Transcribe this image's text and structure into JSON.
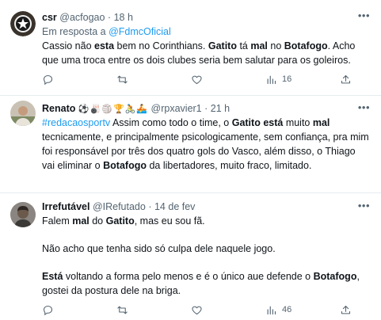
{
  "tweets": [
    {
      "name": "csr",
      "handle": "@acfogao",
      "time": "18 h",
      "reply_prefix": "Em resposta a ",
      "reply_to": "@FdmcOficial",
      "body": [
        {
          "t": "Cassio não "
        },
        {
          "t": "esta",
          "b": true
        },
        {
          "t": " bem no Corinthians. "
        },
        {
          "t": "Gatito",
          "b": true
        },
        {
          "t": " tá "
        },
        {
          "t": "mal",
          "b": true
        },
        {
          "t": " no "
        },
        {
          "t": "Botafogo",
          "b": true
        },
        {
          "t": ". Acho que uma troca entre os dois  clubes seria bem salutar para os goleiros."
        }
      ],
      "views": "16"
    },
    {
      "name": "Renato",
      "name_emojis": "⚽🎳🏐🏆🚴🚣",
      "handle": "@rpxavier1",
      "time": "21 h",
      "body": [
        {
          "t": "#redacaosportv",
          "link": true
        },
        {
          "t": " Assim como todo o time, o "
        },
        {
          "t": "Gatito",
          "b": true
        },
        {
          "t": " "
        },
        {
          "t": "está",
          "b": true
        },
        {
          "t": " muito "
        },
        {
          "t": "mal",
          "b": true
        },
        {
          "t": " tecnicamente, e principalmente psicologicamente, sem confiança, pra mim foi responsável por três dos quatro gols do Vasco, além disso, o Thiago vai eliminar o "
        },
        {
          "t": "Botafogo",
          "b": true
        },
        {
          "t": " da libertadores, muito fraco, limitado."
        }
      ]
    },
    {
      "name": "Irrefutável",
      "handle": "@IRefutado",
      "time": "14 de fev",
      "paragraphs": [
        [
          {
            "t": "Falem "
          },
          {
            "t": "mal",
            "b": true
          },
          {
            "t": " do "
          },
          {
            "t": "Gatito",
            "b": true
          },
          {
            "t": ", mas eu sou fã."
          }
        ],
        [
          {
            "t": "Não acho que tenha sido só culpa dele naquele jogo."
          }
        ],
        [
          {
            "t": "Está",
            "b": true
          },
          {
            "t": " voltando a forma pelo menos e é o único aue defende o "
          },
          {
            "t": "Botafogo",
            "b": true
          },
          {
            "t": ", gostei da postura dele na briga."
          }
        ]
      ],
      "views": "46"
    }
  ],
  "icons": {
    "more": "more-horizontal-icon",
    "reply": "reply-icon",
    "retweet": "retweet-icon",
    "like": "heart-icon",
    "views": "views-icon",
    "share": "share-icon"
  },
  "colors": {
    "link": "#1d9bf0",
    "meta": "#536471",
    "text": "#0f1419",
    "divider": "#e6ecf0"
  }
}
